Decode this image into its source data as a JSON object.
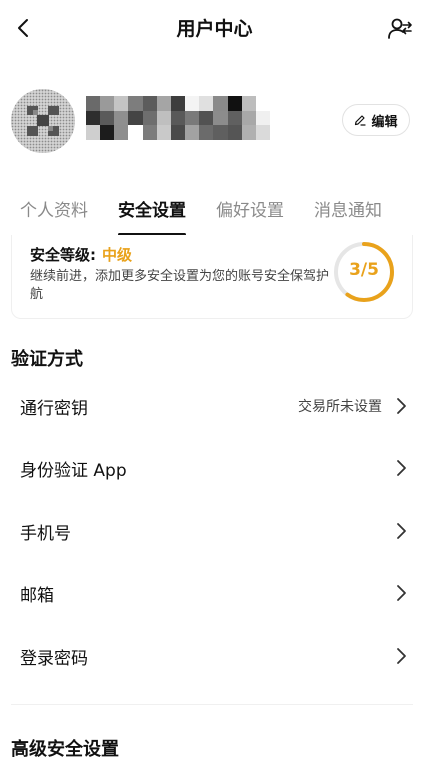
{
  "header": {
    "title": "用户中心",
    "back_icon": "chevron-left-icon",
    "action_icon": "user-switch-icon"
  },
  "profile": {
    "edit_label": "编辑",
    "edit_icon": "pencil-icon"
  },
  "tabs": [
    {
      "label": "个人资料",
      "active": false
    },
    {
      "label": "安全设置",
      "active": true
    },
    {
      "label": "偏好设置",
      "active": false
    },
    {
      "label": "消息通知",
      "active": false
    }
  ],
  "security_level": {
    "label": "安全等级:",
    "level": "中级",
    "description": "继续前进，添加更多安全设置为您的账号安全保驾护航",
    "progress_text": "3/5",
    "progress_fraction": 0.6,
    "accent_color": "#e9a21b"
  },
  "verification": {
    "title": "验证方式",
    "items": [
      {
        "label": "通行密钥",
        "status": "交易所未设置"
      },
      {
        "label": "身份验证 App",
        "status": ""
      },
      {
        "label": "手机号",
        "status": ""
      },
      {
        "label": "邮箱",
        "status": ""
      },
      {
        "label": "登录密码",
        "status": ""
      }
    ]
  },
  "advanced": {
    "title": "高级安全设置"
  }
}
